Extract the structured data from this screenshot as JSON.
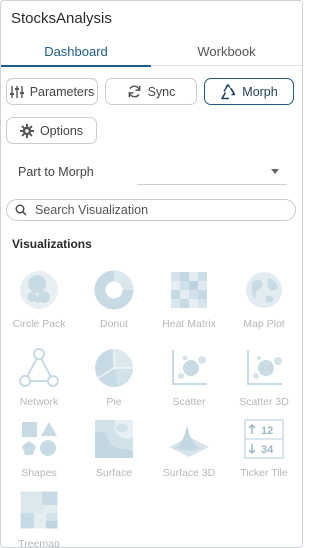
{
  "app": {
    "title": "StocksAnalysis"
  },
  "tabs": [
    {
      "label": "Dashboard"
    },
    {
      "label": "Workbook"
    }
  ],
  "toolbar": {
    "parameters_label": "Parameters",
    "sync_label": "Sync",
    "morph_label": "Morph",
    "options_label": "Options"
  },
  "part_to_morph": {
    "label": "Part to Morph",
    "value": ""
  },
  "search": {
    "placeholder": "Search Visualization"
  },
  "visualizations": {
    "heading": "Visualizations",
    "items": [
      {
        "label": "Circle Pack",
        "icon": "circle-pack-icon"
      },
      {
        "label": "Donut",
        "icon": "donut-icon"
      },
      {
        "label": "Heat Matrix",
        "icon": "heat-matrix-icon"
      },
      {
        "label": "Map Plot",
        "icon": "map-plot-icon"
      },
      {
        "label": "Network",
        "icon": "network-icon"
      },
      {
        "label": "Pie",
        "icon": "pie-icon"
      },
      {
        "label": "Scatter",
        "icon": "scatter-icon"
      },
      {
        "label": "Scatter 3D",
        "icon": "scatter-3d-icon"
      },
      {
        "label": "Shapes",
        "icon": "shapes-icon"
      },
      {
        "label": "Surface",
        "icon": "surface-icon"
      },
      {
        "label": "Surface 3D",
        "icon": "surface-3d-icon"
      },
      {
        "label": "Ticker Tile",
        "icon": "ticker-tile-icon",
        "values": [
          "12",
          "34"
        ]
      },
      {
        "label": "Treemap",
        "icon": "treemap-icon"
      }
    ]
  },
  "colors": {
    "accent": "#1d5d86",
    "icon_fill": "#d6e4ea",
    "icon_stroke": "#bcd0d9"
  }
}
